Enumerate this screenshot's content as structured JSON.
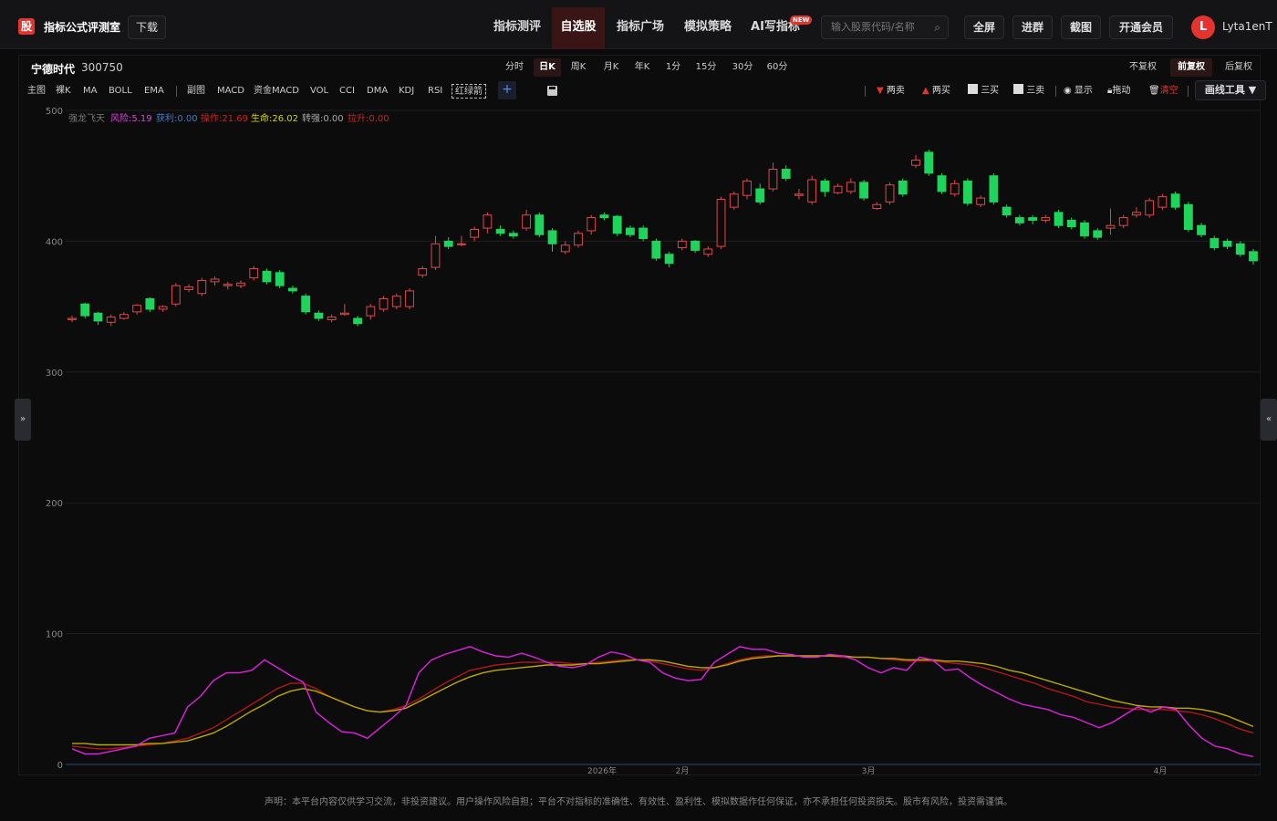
{
  "header": {
    "logo_char": "股",
    "brand": "指标公式评测室",
    "download": "下载",
    "nav": [
      "指标测评",
      "自选股",
      "指标广场",
      "模拟策略",
      "AI写指标"
    ],
    "new_badge": "NEW",
    "search_placeholder": "输入股票代码/名称",
    "buttons": [
      "全屏",
      "进群",
      "截图",
      "开通会员"
    ],
    "avatar_letter": "L",
    "username": "Lyta1enT"
  },
  "stock": {
    "name": "宁德时代",
    "code": "300750"
  },
  "periods": [
    "分时",
    "日K",
    "周K",
    "月K",
    "年K",
    "1分",
    "15分",
    "30分",
    "60分"
  ],
  "adjust": [
    "不复权",
    "前复权",
    "后复权"
  ],
  "indicators": {
    "main_label": "主图",
    "main": [
      "裸K",
      "MA",
      "BOLL",
      "EMA"
    ],
    "sub_label": "副图",
    "sub": [
      "MACD",
      "资金MACD",
      "VOL",
      "CCI",
      "DMA",
      "KDJ",
      "RSI",
      "红绿箭"
    ]
  },
  "tools": {
    "sell2": "两卖",
    "buy2": "两买",
    "buy3": "三买",
    "sell3": "三卖",
    "show": "显示",
    "drag": "拖动",
    "clear": "清空",
    "draw": "画线工具"
  },
  "legend": [
    {
      "text": "强龙飞天",
      "color": "#777"
    },
    {
      "text": "风险:5.19",
      "color": "#e040e0"
    },
    {
      "text": "获利:0.00",
      "color": "#3a7bd5"
    },
    {
      "text": "操作:21.69",
      "color": "#cc2222"
    },
    {
      "text": "生命:26.02",
      "color": "#d4d400"
    },
    {
      "text": "转强:0.00",
      "color": "#aaaaaa"
    },
    {
      "text": "拉升:0.00",
      "color": "#cc2222"
    }
  ],
  "footer": "声明：本平台内容仅供学习交流，非投资建议。用户操作风险自担；平台不对指标的准确性、有效性、盈利性、模拟数据作任何保证，亦不承担任何投资损失。股市有风险，投资需谨慎。",
  "chart_data": {
    "type": "candlestick",
    "y_ticks": [
      0,
      100,
      200,
      300,
      400,
      500
    ],
    "ylim": [
      0,
      500
    ],
    "x_labels": [
      "2026年",
      "2月",
      "3月",
      "4月"
    ],
    "colors": {
      "up": "#e04848",
      "down": "#1fd45a"
    },
    "candles": [
      [
        340,
        341,
        338,
        343
      ],
      [
        352,
        343,
        341,
        353
      ],
      [
        345,
        339,
        336,
        346
      ],
      [
        338,
        342,
        335,
        344
      ],
      [
        341,
        344,
        340,
        346
      ],
      [
        346,
        351,
        344,
        352
      ],
      [
        356,
        348,
        346,
        357
      ],
      [
        348,
        350,
        346,
        351
      ],
      [
        352,
        366,
        350,
        368
      ],
      [
        363,
        365,
        361,
        367
      ],
      [
        360,
        370,
        358,
        372
      ],
      [
        369,
        371,
        366,
        373
      ],
      [
        366,
        367,
        363,
        369
      ],
      [
        366,
        368,
        364,
        370
      ],
      [
        372,
        379,
        370,
        381
      ],
      [
        377,
        369,
        367,
        379
      ],
      [
        376,
        366,
        364,
        378
      ],
      [
        364,
        362,
        360,
        366
      ],
      [
        358,
        346,
        344,
        360
      ],
      [
        345,
        341,
        339,
        347
      ],
      [
        340,
        342,
        338,
        344
      ],
      [
        344,
        345,
        343,
        352
      ],
      [
        341,
        337,
        335,
        343
      ],
      [
        343,
        350,
        340,
        352
      ],
      [
        348,
        356,
        346,
        358
      ],
      [
        350,
        358,
        348,
        360
      ],
      [
        350,
        362,
        348,
        364
      ],
      [
        374,
        379,
        372,
        381
      ],
      [
        380,
        398,
        378,
        404
      ],
      [
        400,
        396,
        394,
        403
      ],
      [
        398,
        398,
        396,
        404
      ],
      [
        403,
        409,
        400,
        411
      ],
      [
        410,
        420,
        406,
        422
      ],
      [
        409,
        406,
        404,
        412
      ],
      [
        406,
        404,
        402,
        408
      ],
      [
        410,
        420,
        408,
        424
      ],
      [
        420,
        405,
        403,
        422
      ],
      [
        408,
        398,
        392,
        410
      ],
      [
        392,
        397,
        390,
        400
      ],
      [
        397,
        406,
        395,
        408
      ],
      [
        408,
        418,
        405,
        420
      ],
      [
        420,
        418,
        416,
        422
      ],
      [
        419,
        406,
        404,
        420
      ],
      [
        410,
        405,
        403,
        412
      ],
      [
        410,
        402,
        400,
        412
      ],
      [
        400,
        387,
        385,
        402
      ],
      [
        390,
        383,
        380,
        392
      ],
      [
        395,
        400,
        393,
        402
      ],
      [
        400,
        393,
        391,
        401
      ],
      [
        390,
        394,
        388,
        396
      ],
      [
        396,
        432,
        394,
        434
      ],
      [
        426,
        436,
        424,
        438
      ],
      [
        435,
        446,
        432,
        448
      ],
      [
        440,
        430,
        428,
        444
      ],
      [
        440,
        455,
        438,
        460
      ],
      [
        455,
        448,
        446,
        458
      ],
      [
        435,
        436,
        432,
        440
      ],
      [
        430,
        447,
        428,
        450
      ],
      [
        446,
        438,
        434,
        448
      ],
      [
        437,
        442,
        436,
        444
      ],
      [
        438,
        445,
        436,
        448
      ],
      [
        445,
        433,
        431,
        447
      ],
      [
        425,
        428,
        424,
        430
      ],
      [
        430,
        443,
        428,
        445
      ],
      [
        446,
        436,
        434,
        448
      ],
      [
        458,
        462,
        456,
        466
      ],
      [
        468,
        452,
        450,
        470
      ],
      [
        450,
        438,
        436,
        452
      ],
      [
        436,
        444,
        434,
        447
      ],
      [
        446,
        429,
        427,
        448
      ],
      [
        428,
        433,
        426,
        435
      ],
      [
        450,
        430,
        428,
        452
      ],
      [
        426,
        420,
        418,
        428
      ],
      [
        418,
        414,
        412,
        420
      ],
      [
        418,
        416,
        413,
        420
      ],
      [
        416,
        418,
        414,
        420
      ],
      [
        422,
        412,
        410,
        424
      ],
      [
        416,
        411,
        409,
        418
      ],
      [
        414,
        404,
        402,
        416
      ],
      [
        408,
        403,
        401,
        410
      ],
      [
        410,
        412,
        405,
        425
      ],
      [
        412,
        418,
        410,
        420
      ],
      [
        420,
        422,
        418,
        426
      ],
      [
        420,
        431,
        418,
        433
      ],
      [
        426,
        434,
        424,
        436
      ],
      [
        436,
        426,
        424,
        438
      ],
      [
        428,
        409,
        407,
        430
      ],
      [
        412,
        405,
        403,
        414
      ],
      [
        402,
        395,
        393,
        404
      ],
      [
        400,
        396,
        394,
        402
      ],
      [
        398,
        390,
        388,
        400
      ],
      [
        392,
        385,
        382,
        394
      ]
    ],
    "oscillator": {
      "magenta": [
        12,
        8,
        8,
        10,
        12,
        14,
        20,
        22,
        24,
        44,
        52,
        64,
        70,
        70,
        72,
        80,
        74,
        68,
        63,
        40,
        32,
        25,
        24,
        20,
        28,
        36,
        45,
        70,
        80,
        84,
        87,
        90,
        86,
        83,
        82,
        85,
        82,
        78,
        75,
        74,
        76,
        82,
        86,
        84,
        80,
        78,
        70,
        66,
        64,
        65,
        78,
        84,
        90,
        88,
        88,
        85,
        84,
        82,
        82,
        84,
        83,
        80,
        74,
        70,
        74,
        72,
        82,
        80,
        72,
        73,
        66,
        60,
        55,
        50,
        46,
        44,
        42,
        38,
        36,
        32,
        28,
        32,
        38,
        44,
        40,
        44,
        42,
        30,
        20,
        14,
        12,
        8,
        6
      ],
      "red": [
        14,
        13,
        12,
        12,
        13,
        14,
        15,
        16,
        18,
        20,
        24,
        28,
        34,
        40,
        46,
        52,
        58,
        62,
        62,
        58,
        52,
        48,
        44,
        41,
        40,
        42,
        45,
        50,
        56,
        62,
        67,
        72,
        74,
        76,
        77,
        78,
        78,
        78,
        78,
        77,
        77,
        78,
        79,
        80,
        80,
        79,
        77,
        75,
        73,
        72,
        74,
        77,
        80,
        82,
        83,
        83,
        83,
        83,
        83,
        83,
        82,
        82,
        82,
        81,
        80,
        79,
        79,
        79,
        78,
        77,
        76,
        74,
        71,
        68,
        65,
        62,
        58,
        55,
        52,
        48,
        46,
        44,
        43,
        42,
        42,
        42,
        41,
        40,
        38,
        35,
        31,
        27,
        24
      ],
      "yellow": [
        16,
        16,
        15,
        15,
        15,
        15,
        16,
        16,
        17,
        18,
        21,
        24,
        29,
        35,
        41,
        46,
        52,
        56,
        58,
        56,
        52,
        48,
        44,
        41,
        40,
        41,
        43,
        48,
        53,
        58,
        63,
        67,
        70,
        72,
        73,
        74,
        75,
        76,
        76,
        76,
        77,
        77,
        78,
        79,
        80,
        80,
        79,
        77,
        75,
        74,
        74,
        76,
        79,
        81,
        82,
        83,
        83,
        83,
        83,
        83,
        83,
        82,
        82,
        81,
        81,
        80,
        80,
        80,
        79,
        79,
        78,
        77,
        75,
        72,
        70,
        67,
        64,
        61,
        58,
        55,
        52,
        49,
        47,
        45,
        44,
        44,
        43,
        43,
        42,
        40,
        37,
        33,
        29
      ]
    }
  }
}
